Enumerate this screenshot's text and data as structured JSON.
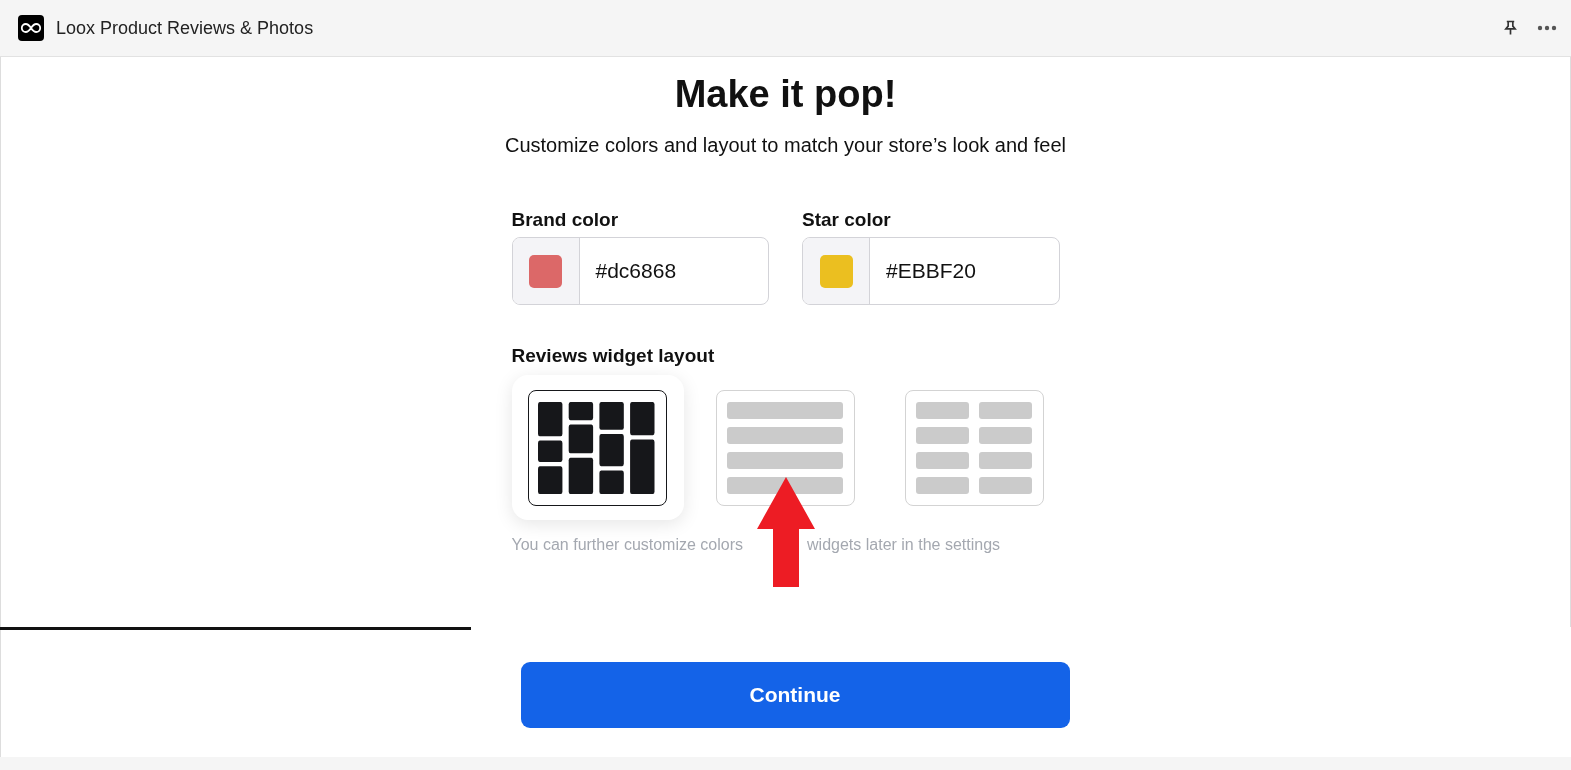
{
  "window": {
    "title": "Loox Product Reviews & Photos"
  },
  "heading": "Make it pop!",
  "subtitle": "Customize colors and layout to match your store’s look and feel",
  "color_fields": [
    {
      "label": "Brand color",
      "value": "#dc6868",
      "color": "#dc6868"
    },
    {
      "label": "Star color",
      "value": "#EBBF20",
      "color": "#ebbf20"
    }
  ],
  "layout_heading": "Reviews widget layout",
  "layouts": [
    {
      "kind": "masonry",
      "selected": true
    },
    {
      "kind": "list",
      "selected": false
    },
    {
      "kind": "grid",
      "selected": false
    }
  ],
  "note": [
    "You can further customize colors",
    "widgets later in the settings"
  ],
  "progress": {
    "level": 0.3
  },
  "continue_button": "Continue"
}
